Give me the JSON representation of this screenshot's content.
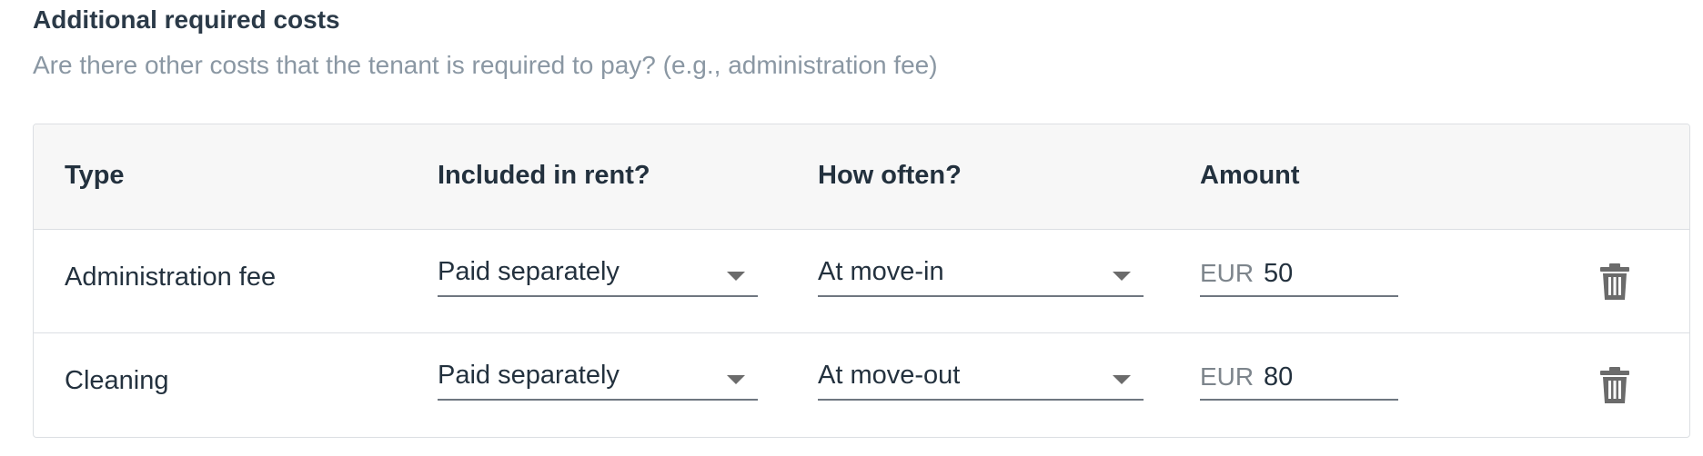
{
  "section": {
    "title": "Additional required costs",
    "subtitle": "Are there other costs that the tenant is required to pay? (e.g., administration fee)"
  },
  "table": {
    "headers": {
      "type": "Type",
      "included": "Included in rent?",
      "frequency": "How often?",
      "amount": "Amount"
    },
    "rows": [
      {
        "type": "Administration fee",
        "included": "Paid separately",
        "frequency": "At move-in",
        "currency": "EUR",
        "amount": "50",
        "delete_icon": "trash-icon"
      },
      {
        "type": "Cleaning",
        "included": "Paid separately",
        "frequency": "At move-out",
        "currency": "EUR",
        "amount": "80",
        "delete_icon": "trash-icon"
      }
    ]
  },
  "colors": {
    "header_bg": "#f7f7f7",
    "border": "#dcdfe3",
    "subtitle": "#8a97a3",
    "icon": "#6b6b6b"
  }
}
